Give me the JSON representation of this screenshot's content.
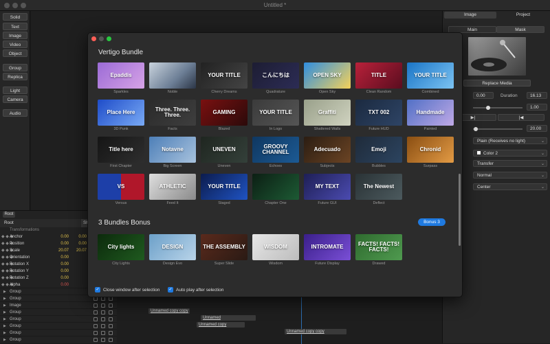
{
  "window": {
    "title": "Untitled *"
  },
  "toolbar": {
    "buttons": [
      "Solid",
      "Text",
      "Image",
      "Video",
      "Object",
      "Group",
      "Replica",
      "Light",
      "Camera",
      "Audio"
    ]
  },
  "inspector": {
    "tabs": [
      "Image",
      "Project"
    ],
    "subtabs": [
      "Main",
      "Mask"
    ],
    "replace_media": "Replace Media",
    "start_value": "0.00",
    "duration_label": "Duration",
    "duration_value": "16.13",
    "slider1_value": "1.00",
    "slider1_level": 0.3,
    "slider2_value": "20.00",
    "slider2_level": 0.05,
    "lighting": "Plain (Receives no light)",
    "color_label": "Color 2",
    "transfer": "Transfer",
    "blend": "Normal",
    "align": "Center"
  },
  "layers": {
    "tab": "Root",
    "header": "Root",
    "header_right": "Sh",
    "section": "Transformations",
    "props": [
      {
        "name": "Anchor",
        "v1": "0.00",
        "v2": "0.00"
      },
      {
        "name": "Position",
        "v1": "0.00",
        "v2": "0.00"
      },
      {
        "name": "Scale",
        "v1": "20.07",
        "v2": "20.07"
      },
      {
        "name": "Orientation",
        "v1": "0.00",
        "v2": ""
      },
      {
        "name": "Rotation X",
        "v1": "0.00",
        "v2": ""
      },
      {
        "name": "Rotation Y",
        "v1": "0.00",
        "v2": ""
      },
      {
        "name": "Rotation Z",
        "v1": "0.00",
        "v2": ""
      },
      {
        "name": "Alpha",
        "v1": "0.00",
        "v2": ""
      }
    ],
    "groups": [
      "Group",
      "Group",
      "Image",
      "Group",
      "Group",
      "Group",
      "Group",
      "Group"
    ]
  },
  "timeline": {
    "clips": [
      "Unnamed copy copy",
      "Unnamed",
      "Unnamed copy",
      "Unnamed copy copy"
    ]
  },
  "modal": {
    "section1": "Vertigo Bundle",
    "section2": "3 Bundles Bonus",
    "bonus_badge": "Bonus 3",
    "close_after": "Close window after selection",
    "autoplay_after": "Auto play after selection",
    "items": [
      {
        "label": "Sparkles",
        "text": "Epaddis",
        "bg": "linear-gradient(135deg,#9b6bd6,#d7a3e6)"
      },
      {
        "label": "Noble",
        "text": "",
        "bg": "linear-gradient(135deg,#c9d3dd,#6d7f96 60%,#2b3546)"
      },
      {
        "label": "Cherry Dreams",
        "text": "YOUR TITLE",
        "bg": "linear-gradient(135deg,#222,#444)"
      },
      {
        "label": "Quadrature",
        "text": "こんにちは",
        "bg": "linear-gradient(135deg,#1d1d33,#2c2c55)"
      },
      {
        "label": "Open Sky",
        "text": "OPEN SKY",
        "bg": "linear-gradient(135deg,#2f8ee0,#f4d15a)"
      },
      {
        "label": "Clean Random",
        "text": "TITLE",
        "bg": "linear-gradient(135deg,#b9213a,#5a0d1f)"
      },
      {
        "label": "Combined",
        "text": "YOUR TITLE",
        "bg": "linear-gradient(135deg,#1a75c7,#7cc3f2)"
      },
      {
        "label": "3D Punk",
        "text": "Place Here",
        "bg": "linear-gradient(135deg,#1e4cc9,#79aaf5)"
      },
      {
        "label": "Facts",
        "text": "Three. Three. Three.",
        "bg": "linear-gradient(135deg,#2b2b2b,#3e3e3e)"
      },
      {
        "label": "Blazed",
        "text": "GAMING",
        "bg": "linear-gradient(135deg,#7a1010,#2b0a0a)"
      },
      {
        "label": "In Logo",
        "text": "YOUR TITLE",
        "bg": "linear-gradient(135deg,#3b3b3b,#555)"
      },
      {
        "label": "Shattered Walls",
        "text": "Graffiti",
        "bg": "linear-gradient(135deg,#99a08a,#d0d3c0)"
      },
      {
        "label": "Future HUD",
        "text": "TXT 002",
        "bg": "linear-gradient(135deg,#1b2a40,#2e4465)"
      },
      {
        "label": "Painted",
        "text": "Handmade",
        "bg": "linear-gradient(135deg,#5170c6,#c0a9e6)"
      },
      {
        "label": "First Chapter",
        "text": "Title here",
        "bg": "linear-gradient(135deg,#151515,#2e2e2e)"
      },
      {
        "label": "Big Screen",
        "text": "Notavne",
        "bg": "linear-gradient(135deg,#4d7fb8,#a8c2dd)"
      },
      {
        "label": "Uneven",
        "text": "UNEVEN",
        "bg": "linear-gradient(135deg,#1f2620,#34403a)"
      },
      {
        "label": "Echoes",
        "text": "GROOVY CHANNEL",
        "bg": "linear-gradient(135deg,#0f3760,#1c5a94)"
      },
      {
        "label": "Subjects",
        "text": "Adecuado",
        "bg": "linear-gradient(135deg,#2b1d12,#6b4424)"
      },
      {
        "label": "Bubbles",
        "text": "Emoji",
        "bg": "linear-gradient(135deg,#1f2b3a,#2c4460)"
      },
      {
        "label": "Surpass",
        "text": "Chronid",
        "bg": "linear-gradient(135deg,#8a4e12,#e39b45)"
      },
      {
        "label": "Versus",
        "text": "VS",
        "bg": "linear-gradient(90deg,#1d3fa8 50%,#b0172a 50%)"
      },
      {
        "label": "Feed It",
        "text": "ATHLETIC",
        "bg": "linear-gradient(135deg,#dedede,#8a8a8a)"
      },
      {
        "label": "Staged",
        "text": "YOUR TITLE",
        "bg": "linear-gradient(135deg,#0c1c4d,#1f53c3)"
      },
      {
        "label": "Chapter One",
        "text": "",
        "bg": "linear-gradient(135deg,#0c1f14,#1d5a34)"
      },
      {
        "label": "Future GUI",
        "text": "MY TEXT",
        "bg": "linear-gradient(135deg,#1e1f55,#4b4bb0)"
      },
      {
        "label": "Deflect",
        "text": "The Newest",
        "bg": "linear-gradient(135deg,#2a3336,#4c5a5e)"
      }
    ],
    "bonus_items": [
      {
        "label": "City Lights",
        "text": "City lights",
        "bg": "linear-gradient(135deg,#0c2a0c,#1f5a1f)"
      },
      {
        "label": "Design Evo",
        "text": "DESIGN",
        "bg": "linear-gradient(135deg,#6ca0c9,#b9d4e9)"
      },
      {
        "label": "Super Slide",
        "text": "THE ASSEMBLY",
        "bg": "linear-gradient(135deg,#5a2a1c,#2a1a14)"
      },
      {
        "label": "Wisdom",
        "text": "WISDOM",
        "bg": "linear-gradient(135deg,#e6e6e6,#bdbdbd)"
      },
      {
        "label": "Future Display",
        "text": "INTROMATE",
        "bg": "linear-gradient(135deg,#3a1f8a,#7a4fd6)"
      },
      {
        "label": "Drawed",
        "text": "FACTS! FACTS! FACTS!",
        "bg": "linear-gradient(135deg,#2f6b2f,#4f9a4f)"
      }
    ]
  }
}
